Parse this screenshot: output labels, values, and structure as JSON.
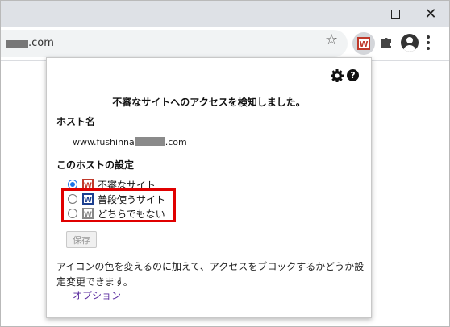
{
  "browser": {
    "url_suffix": ".com",
    "window_controls": {
      "minimize": "minimize",
      "maximize": "maximize",
      "close": "✕"
    }
  },
  "toolbar_icons": [
    "star-icon",
    "extension-icon",
    "puzzle-icon",
    "profile-icon",
    "menu-icon"
  ],
  "popup": {
    "help_label": "?",
    "title": "不審なサイトへのアクセスを検知しました。",
    "host_heading": "ホスト名",
    "host_prefix": "www.fushinna",
    "host_suffix": ".com",
    "settings_heading": "このホストの設定",
    "options": [
      {
        "label": "不審なサイト",
        "checked": true,
        "icon_color": "#c0392b"
      },
      {
        "label": "普段使うサイト",
        "checked": false,
        "icon_color": "#1d3f8f"
      },
      {
        "label": "どちらでもない",
        "checked": false,
        "icon_color": "#888888"
      }
    ],
    "save_label": "保存",
    "description": "アイコンの色を変えるのに加えて、アクセスをブロックするかどうか設定変更できます。",
    "options_link": "オプション"
  },
  "colors": {
    "highlight": "#e00000",
    "radio_accent": "#1a73e8",
    "link": "#5b2d9f"
  }
}
